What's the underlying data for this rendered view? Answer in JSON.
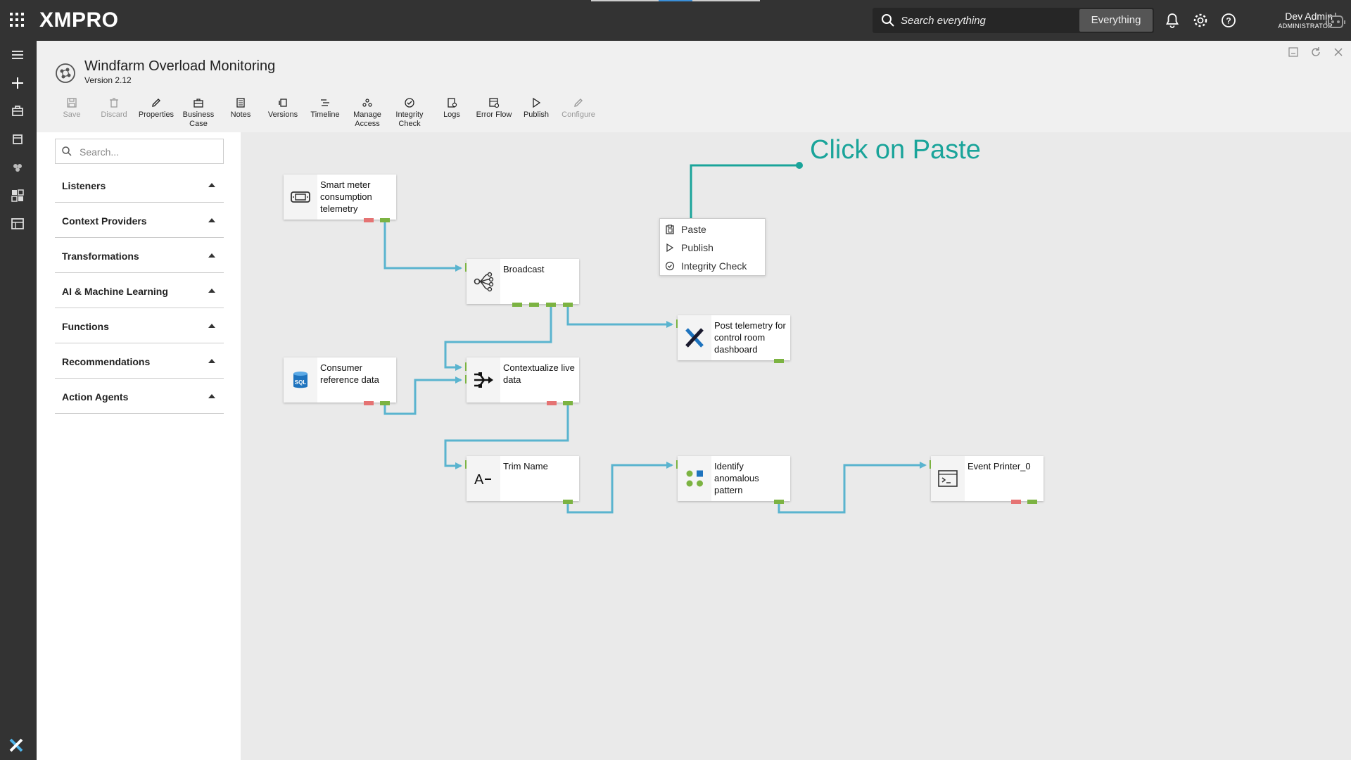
{
  "app": {
    "logo": "XMPRO",
    "search_placeholder": "Search everything",
    "search_scope": "Everything",
    "user_name": "Dev Admin",
    "user_role": "ADMINISTRATOR"
  },
  "header": {
    "title": "Windfarm Overload Monitoring",
    "version": "Version 2.12"
  },
  "toolbar": [
    {
      "label": "Save",
      "icon": "save-icon",
      "disabled": true
    },
    {
      "label": "Discard",
      "icon": "trash-icon",
      "disabled": true
    },
    {
      "label": "Properties",
      "icon": "pencil-icon",
      "disabled": false
    },
    {
      "label": "Business Case",
      "icon": "briefcase-icon",
      "disabled": false
    },
    {
      "label": "Notes",
      "icon": "notes-icon",
      "disabled": false
    },
    {
      "label": "Versions",
      "icon": "versions-icon",
      "disabled": false
    },
    {
      "label": "Timeline",
      "icon": "timeline-icon",
      "disabled": false
    },
    {
      "label": "Manage Access",
      "icon": "access-icon",
      "disabled": false
    },
    {
      "label": "Integrity Check",
      "icon": "check-circle-icon",
      "disabled": false
    },
    {
      "label": "Logs",
      "icon": "logs-icon",
      "disabled": false
    },
    {
      "label": "Error Flow",
      "icon": "error-flow-icon",
      "disabled": false
    },
    {
      "label": "Publish",
      "icon": "play-icon",
      "disabled": false
    },
    {
      "label": "Configure",
      "icon": "pencil-icon",
      "disabled": true
    }
  ],
  "panel": {
    "search_placeholder": "Search...",
    "categories": [
      "Listeners",
      "Context Providers",
      "Transformations",
      "AI & Machine Learning",
      "Functions",
      "Recommendations",
      "Action Agents"
    ]
  },
  "nodes": [
    {
      "id": "smart-meter",
      "label": "Smart meter consumption telemetry",
      "icon": "meter-icon"
    },
    {
      "id": "broadcast",
      "label": "Broadcast",
      "icon": "broadcast-icon"
    },
    {
      "id": "consumer",
      "label": "Consumer reference data",
      "icon": "sql-icon"
    },
    {
      "id": "contextualize",
      "label": "Contextualize live data",
      "icon": "merge-icon"
    },
    {
      "id": "post-telemetry",
      "label": "Post telemetry for control room dashboard",
      "icon": "xmpro-icon"
    },
    {
      "id": "trim",
      "label": "Trim Name",
      "icon": "text-trim-icon"
    },
    {
      "id": "identify",
      "label": "Identify anomalous pattern",
      "icon": "ml-icon"
    },
    {
      "id": "printer",
      "label": "Event Printer_0",
      "icon": "terminal-icon"
    }
  ],
  "context_menu": [
    {
      "label": "Paste",
      "icon": "clipboard-icon"
    },
    {
      "label": "Publish",
      "icon": "play-icon"
    },
    {
      "label": "Integrity Check",
      "icon": "check-circle-icon"
    }
  ],
  "annotation": "Click on Paste",
  "colors": {
    "wire": "#5ab4cf",
    "port_ok": "#7cb342",
    "port_err": "#e57373",
    "annotation": "#1aa49a",
    "bar": "#333333"
  }
}
